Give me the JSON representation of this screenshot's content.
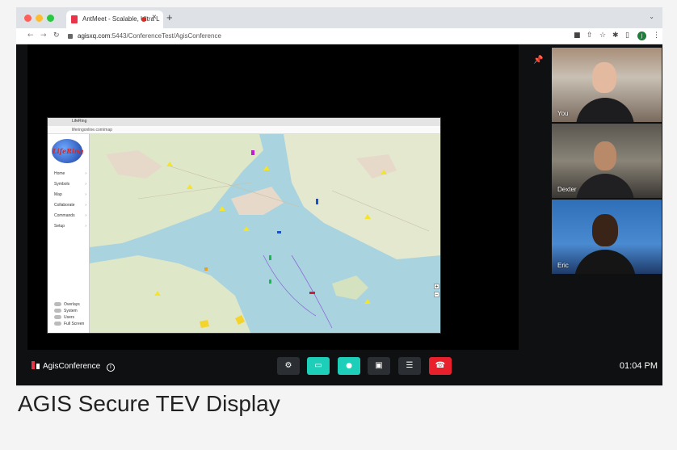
{
  "browser": {
    "tab_title": "AntMeet - Scalable, Ultra L",
    "tab_close": "×",
    "new_tab": "+",
    "tab_menu": "⌄",
    "url_host": "agisxq.com",
    "url_rest": ":5443/ConferenceTest/AgisConference",
    "profile_initial": "J"
  },
  "shared_screen": {
    "tab_title": "LifeRing",
    "url": "liferingonline.com/map",
    "logo_text": "LifeRing",
    "menu": [
      "Home",
      "Symbols",
      "Map",
      "Collaborate",
      "Commands",
      "Setup"
    ],
    "toggles": [
      "Overlays",
      "System",
      "Users",
      "Full Screen"
    ]
  },
  "participants": [
    {
      "name": "You"
    },
    {
      "name": "Dexter"
    },
    {
      "name": "Eric"
    }
  ],
  "toolbar": {
    "room_name": "AgisConference",
    "info_icon": "i",
    "time": "01:04 PM"
  },
  "caption": "AGIS Secure TEV Display",
  "colors": {
    "camera_active": "#1dcfb8",
    "mic_active": "#1dcfb8",
    "end_call": "#e8202c",
    "button_dark": "#2b2f33"
  },
  "icons": {
    "settings": "⚙",
    "camera": "▭",
    "mic": "🎤",
    "screen_share": "▣",
    "chat": "☰",
    "end_call": "☎",
    "pin": "📌"
  }
}
